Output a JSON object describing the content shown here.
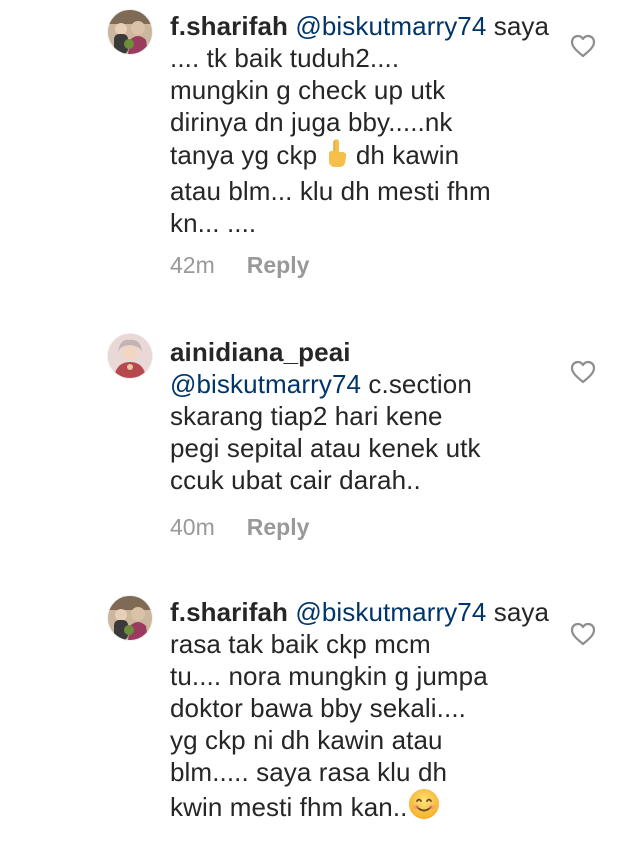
{
  "comments": [
    {
      "username": "f.sharifah",
      "mention": "@biskutmarry74",
      "text_before_emoji": " saya .... tk baik tuduh2....\nmungkin g check up utk\ndirinya dn juga bby.....nk\ntanya yg ckp ",
      "emoji": "pointing-finger-icon",
      "text_after_emoji": "  dh kawin\natau blm... klu dh mesti fhm\nkn... ....",
      "time": "42m",
      "reply_label": "Reply"
    },
    {
      "username": "ainidiana_peai",
      "mention": "@biskutmarry74",
      "text": " c.section\nskarang tiap2 hari kene\npegi sepital atau kenek utk\nccuk ubat cair darah..",
      "time": "40m",
      "reply_label": "Reply"
    },
    {
      "username": "f.sharifah",
      "mention": "@biskutmarry74",
      "text_before_emoji": " saya rasa tak baik ckp mcm\ntu.... nora mungkin g jumpa\ndoktor bawa bby sekali....\nyg ckp ni dh kawin atau\nblm..... saya rasa klu dh\nkwin mesti fhm kan..",
      "emoji": "smiling-face-icon"
    }
  ],
  "colors": {
    "text": "#262626",
    "mention": "#003569",
    "meta": "#999999"
  }
}
